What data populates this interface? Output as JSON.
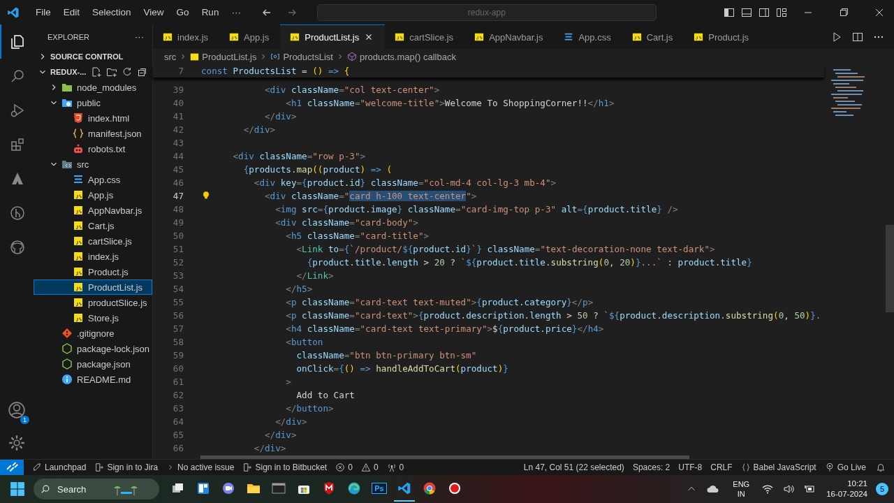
{
  "titlebar": {
    "menu": [
      "File",
      "Edit",
      "Selection",
      "View",
      "Go",
      "Run",
      "···"
    ],
    "command_center": "redux-app"
  },
  "activity_bar": [
    {
      "kind": "explorer",
      "selected": true
    },
    {
      "kind": "search",
      "selected": false
    },
    {
      "kind": "debug",
      "selected": false
    },
    {
      "kind": "extensions",
      "selected": false
    },
    {
      "kind": "atlassian",
      "selected": false
    },
    {
      "kind": "git-graph",
      "selected": false
    },
    {
      "kind": "github",
      "selected": false
    }
  ],
  "accounts_badge": "1",
  "sidebar": {
    "title": "EXPLORER",
    "more": "···",
    "sections": [
      {
        "label": "SOURCE CONTROL",
        "expanded": false
      },
      {
        "label": "REDUX-...",
        "expanded": true,
        "children": [
          {
            "name": "node_modules",
            "kind": "folder-node",
            "expanded": false,
            "selected": false
          },
          {
            "name": "public",
            "kind": "folder-public",
            "expanded": true,
            "selected": false,
            "children": [
              {
                "name": "index.html",
                "kind": "html",
                "selected": false
              },
              {
                "name": "manifest.json",
                "kind": "json",
                "selected": false
              },
              {
                "name": "robots.txt",
                "kind": "robot",
                "selected": false
              }
            ]
          },
          {
            "name": "src",
            "kind": "folder-src",
            "expanded": true,
            "selected": false,
            "children": [
              {
                "name": "App.css",
                "kind": "css",
                "selected": false
              },
              {
                "name": "App.js",
                "kind": "js",
                "selected": false
              },
              {
                "name": "AppNavbar.js",
                "kind": "js",
                "selected": false
              },
              {
                "name": "Cart.js",
                "kind": "js",
                "selected": false
              },
              {
                "name": "cartSlice.js",
                "kind": "js",
                "selected": false
              },
              {
                "name": "index.js",
                "kind": "js",
                "selected": false
              },
              {
                "name": "Product.js",
                "kind": "js",
                "selected": false
              },
              {
                "name": "ProductList.js",
                "kind": "js",
                "selected": true
              },
              {
                "name": "productSlice.js",
                "kind": "js",
                "selected": false
              },
              {
                "name": "Store.js",
                "kind": "js",
                "selected": false
              }
            ]
          },
          {
            "name": ".gitignore",
            "kind": "git",
            "selected": false
          },
          {
            "name": "package-lock.json",
            "kind": "npm",
            "selected": false
          },
          {
            "name": "package.json",
            "kind": "npm",
            "selected": false
          },
          {
            "name": "README.md",
            "kind": "info",
            "selected": false
          }
        ]
      }
    ]
  },
  "tabs": [
    {
      "label": "index.js",
      "kind": "js",
      "selected": false
    },
    {
      "label": "App.js",
      "kind": "js",
      "selected": false
    },
    {
      "label": "ProductList.js",
      "kind": "js",
      "selected": true
    },
    {
      "label": "cartSlice.js",
      "kind": "js",
      "selected": false
    },
    {
      "label": "AppNavbar.js",
      "kind": "js",
      "selected": false
    },
    {
      "label": "App.css",
      "kind": "css",
      "selected": false
    },
    {
      "label": "Cart.js",
      "kind": "js",
      "selected": false
    },
    {
      "label": "Product.js",
      "kind": "js",
      "selected": false
    }
  ],
  "breadcrumbs": [
    {
      "label": "src",
      "kind": "folder"
    },
    {
      "label": "ProductList.js",
      "kind": "js"
    },
    {
      "label": "ProductsList",
      "kind": "variable"
    },
    {
      "label": "products.map() callback",
      "kind": "method"
    }
  ],
  "sticky_line": {
    "n": "7",
    "code": [
      {
        "kind": "k",
        "text": "const"
      },
      {
        "kind": "v",
        "text": " ProductsList"
      },
      {
        "kind": "t",
        "text": " = "
      },
      {
        "kind": "y",
        "text": "()"
      },
      {
        "kind": "k",
        "text": " =>"
      },
      {
        "kind": "y",
        "text": " {"
      }
    ]
  },
  "lines": [
    {
      "n": "39",
      "current": false,
      "code": [
        {
          "kind": "p",
          "text": "            <"
        },
        {
          "kind": "tag",
          "text": "div"
        },
        {
          "kind": "a",
          "text": " className"
        },
        {
          "kind": "p",
          "text": "="
        },
        {
          "kind": "s",
          "text": "\"col text-center\""
        },
        {
          "kind": "p",
          "text": ">"
        }
      ]
    },
    {
      "n": "40",
      "current": false,
      "code": [
        {
          "kind": "p",
          "text": "                <"
        },
        {
          "kind": "tag",
          "text": "h1"
        },
        {
          "kind": "a",
          "text": " className"
        },
        {
          "kind": "p",
          "text": "="
        },
        {
          "kind": "s",
          "text": "\"welcome-title\""
        },
        {
          "kind": "p",
          "text": ">"
        },
        {
          "kind": "t",
          "text": "Welcome To ShoppingCorner!!"
        },
        {
          "kind": "p",
          "text": "</"
        },
        {
          "kind": "tag",
          "text": "h1"
        },
        {
          "kind": "p",
          "text": ">"
        }
      ]
    },
    {
      "n": "41",
      "current": false,
      "code": [
        {
          "kind": "p",
          "text": "            </"
        },
        {
          "kind": "tag",
          "text": "div"
        },
        {
          "kind": "p",
          "text": ">"
        }
      ]
    },
    {
      "n": "42",
      "current": false,
      "code": [
        {
          "kind": "p",
          "text": "        </"
        },
        {
          "kind": "tag",
          "text": "div"
        },
        {
          "kind": "p",
          "text": ">"
        }
      ]
    },
    {
      "n": "43",
      "current": false
    },
    {
      "n": "44",
      "current": false,
      "code": [
        {
          "kind": "p",
          "text": "      <"
        },
        {
          "kind": "tag",
          "text": "div"
        },
        {
          "kind": "a",
          "text": " className"
        },
        {
          "kind": "p",
          "text": "="
        },
        {
          "kind": "s",
          "text": "\"row p-3\""
        },
        {
          "kind": "p",
          "text": ">"
        }
      ]
    },
    {
      "n": "45",
      "current": false,
      "code": [
        {
          "kind": "b",
          "text": "        {"
        },
        {
          "kind": "v",
          "text": "products"
        },
        {
          "kind": "t",
          "text": "."
        },
        {
          "kind": "f",
          "text": "map"
        },
        {
          "kind": "y",
          "text": "(("
        },
        {
          "kind": "v",
          "text": "product"
        },
        {
          "kind": "y",
          "text": ")"
        },
        {
          "kind": "k",
          "text": " =>"
        },
        {
          "kind": "y",
          "text": " ("
        }
      ]
    },
    {
      "n": "46",
      "current": false,
      "code": [
        {
          "kind": "p",
          "text": "          <"
        },
        {
          "kind": "tag",
          "text": "div"
        },
        {
          "kind": "a",
          "text": " key"
        },
        {
          "kind": "p",
          "text": "="
        },
        {
          "kind": "b",
          "text": "{"
        },
        {
          "kind": "v",
          "text": "product"
        },
        {
          "kind": "t",
          "text": "."
        },
        {
          "kind": "v",
          "text": "id"
        },
        {
          "kind": "b",
          "text": "}"
        },
        {
          "kind": "a",
          "text": " className"
        },
        {
          "kind": "p",
          "text": "="
        },
        {
          "kind": "s",
          "text": "\"col-md-4 col-lg-3 mb-4\""
        },
        {
          "kind": "p",
          "text": ">"
        }
      ]
    },
    {
      "n": "47",
      "current": true,
      "code": [
        {
          "kind": "p",
          "text": "            <"
        },
        {
          "kind": "tag",
          "text": "div"
        },
        {
          "kind": "a",
          "text": " className"
        },
        {
          "kind": "p",
          "text": "="
        },
        {
          "kind": "s",
          "text": "\""
        },
        {
          "kind": "sel",
          "text": "card h-100 text-center"
        },
        {
          "kind": "s",
          "text": "\""
        },
        {
          "kind": "p",
          "text": ">"
        }
      ]
    },
    {
      "n": "48",
      "current": false,
      "code": [
        {
          "kind": "p",
          "text": "              <"
        },
        {
          "kind": "tag",
          "text": "img"
        },
        {
          "kind": "a",
          "text": " src"
        },
        {
          "kind": "p",
          "text": "="
        },
        {
          "kind": "b",
          "text": "{"
        },
        {
          "kind": "v",
          "text": "product"
        },
        {
          "kind": "t",
          "text": "."
        },
        {
          "kind": "v",
          "text": "image"
        },
        {
          "kind": "b",
          "text": "}"
        },
        {
          "kind": "a",
          "text": " className"
        },
        {
          "kind": "p",
          "text": "="
        },
        {
          "kind": "s",
          "text": "\"card-img-top p-3\""
        },
        {
          "kind": "a",
          "text": " alt"
        },
        {
          "kind": "p",
          "text": "="
        },
        {
          "kind": "b",
          "text": "{"
        },
        {
          "kind": "v",
          "text": "product"
        },
        {
          "kind": "t",
          "text": "."
        },
        {
          "kind": "v",
          "text": "title"
        },
        {
          "kind": "b",
          "text": "}"
        },
        {
          "kind": "p",
          "text": " />"
        }
      ]
    },
    {
      "n": "49",
      "current": false,
      "code": [
        {
          "kind": "p",
          "text": "              <"
        },
        {
          "kind": "tag",
          "text": "div"
        },
        {
          "kind": "a",
          "text": " className"
        },
        {
          "kind": "p",
          "text": "="
        },
        {
          "kind": "s",
          "text": "\"card-body\""
        },
        {
          "kind": "p",
          "text": ">"
        }
      ]
    },
    {
      "n": "50",
      "current": false,
      "code": [
        {
          "kind": "p",
          "text": "                <"
        },
        {
          "kind": "tag",
          "text": "h5"
        },
        {
          "kind": "a",
          "text": " className"
        },
        {
          "kind": "p",
          "text": "="
        },
        {
          "kind": "s",
          "text": "\"card-title\""
        },
        {
          "kind": "p",
          "text": ">"
        }
      ]
    },
    {
      "n": "51",
      "current": false,
      "code": [
        {
          "kind": "p",
          "text": "                  <"
        },
        {
          "kind": "c",
          "text": "Link"
        },
        {
          "kind": "a",
          "text": " to"
        },
        {
          "kind": "p",
          "text": "="
        },
        {
          "kind": "b",
          "text": "{"
        },
        {
          "kind": "s",
          "text": "`/product/"
        },
        {
          "kind": "b",
          "text": "${"
        },
        {
          "kind": "v",
          "text": "product"
        },
        {
          "kind": "t",
          "text": "."
        },
        {
          "kind": "v",
          "text": "id"
        },
        {
          "kind": "b",
          "text": "}"
        },
        {
          "kind": "s",
          "text": "`"
        },
        {
          "kind": "b",
          "text": "}"
        },
        {
          "kind": "a",
          "text": " className"
        },
        {
          "kind": "p",
          "text": "="
        },
        {
          "kind": "s",
          "text": "\"text-decoration-none text-dark\""
        },
        {
          "kind": "p",
          "text": ">"
        }
      ]
    },
    {
      "n": "52",
      "current": false,
      "code": [
        {
          "kind": "b",
          "text": "                    {"
        },
        {
          "kind": "v",
          "text": "product"
        },
        {
          "kind": "t",
          "text": "."
        },
        {
          "kind": "v",
          "text": "title"
        },
        {
          "kind": "t",
          "text": "."
        },
        {
          "kind": "v",
          "text": "length"
        },
        {
          "kind": "t",
          "text": " > "
        },
        {
          "kind": "n",
          "text": "20"
        },
        {
          "kind": "t",
          "text": " ? "
        },
        {
          "kind": "s",
          "text": "`"
        },
        {
          "kind": "b",
          "text": "${"
        },
        {
          "kind": "v",
          "text": "product"
        },
        {
          "kind": "t",
          "text": "."
        },
        {
          "kind": "v",
          "text": "title"
        },
        {
          "kind": "t",
          "text": "."
        },
        {
          "kind": "f",
          "text": "substring"
        },
        {
          "kind": "y",
          "text": "("
        },
        {
          "kind": "n",
          "text": "0"
        },
        {
          "kind": "t",
          "text": ", "
        },
        {
          "kind": "n",
          "text": "20"
        },
        {
          "kind": "y",
          "text": ")"
        },
        {
          "kind": "b",
          "text": "}"
        },
        {
          "kind": "s",
          "text": "...`"
        },
        {
          "kind": "t",
          "text": " : "
        },
        {
          "kind": "v",
          "text": "product"
        },
        {
          "kind": "t",
          "text": "."
        },
        {
          "kind": "v",
          "text": "title"
        },
        {
          "kind": "b",
          "text": "}"
        }
      ]
    },
    {
      "n": "53",
      "current": false,
      "code": [
        {
          "kind": "p",
          "text": "                  </"
        },
        {
          "kind": "c",
          "text": "Link"
        },
        {
          "kind": "p",
          "text": ">"
        }
      ]
    },
    {
      "n": "54",
      "current": false,
      "code": [
        {
          "kind": "p",
          "text": "                </"
        },
        {
          "kind": "tag",
          "text": "h5"
        },
        {
          "kind": "p",
          "text": ">"
        }
      ]
    },
    {
      "n": "55",
      "current": false,
      "code": [
        {
          "kind": "p",
          "text": "                <"
        },
        {
          "kind": "tag",
          "text": "p"
        },
        {
          "kind": "a",
          "text": " className"
        },
        {
          "kind": "p",
          "text": "="
        },
        {
          "kind": "s",
          "text": "\"card-text text-muted\""
        },
        {
          "kind": "p",
          "text": ">"
        },
        {
          "kind": "b",
          "text": "{"
        },
        {
          "kind": "v",
          "text": "product"
        },
        {
          "kind": "t",
          "text": "."
        },
        {
          "kind": "v",
          "text": "category"
        },
        {
          "kind": "b",
          "text": "}"
        },
        {
          "kind": "p",
          "text": "</"
        },
        {
          "kind": "tag",
          "text": "p"
        },
        {
          "kind": "p",
          "text": ">"
        }
      ]
    },
    {
      "n": "56",
      "current": false,
      "code": [
        {
          "kind": "p",
          "text": "                <"
        },
        {
          "kind": "tag",
          "text": "p"
        },
        {
          "kind": "a",
          "text": " className"
        },
        {
          "kind": "p",
          "text": "="
        },
        {
          "kind": "s",
          "text": "\"card-text\""
        },
        {
          "kind": "p",
          "text": ">"
        },
        {
          "kind": "b",
          "text": "{"
        },
        {
          "kind": "v",
          "text": "product"
        },
        {
          "kind": "t",
          "text": "."
        },
        {
          "kind": "v",
          "text": "description"
        },
        {
          "kind": "t",
          "text": "."
        },
        {
          "kind": "v",
          "text": "length"
        },
        {
          "kind": "t",
          "text": " > "
        },
        {
          "kind": "n",
          "text": "50"
        },
        {
          "kind": "t",
          "text": " ? "
        },
        {
          "kind": "s",
          "text": "`"
        },
        {
          "kind": "b",
          "text": "${"
        },
        {
          "kind": "v",
          "text": "product"
        },
        {
          "kind": "t",
          "text": "."
        },
        {
          "kind": "v",
          "text": "description"
        },
        {
          "kind": "t",
          "text": "."
        },
        {
          "kind": "f",
          "text": "substring"
        },
        {
          "kind": "y",
          "text": "("
        },
        {
          "kind": "n",
          "text": "0"
        },
        {
          "kind": "t",
          "text": ", "
        },
        {
          "kind": "n",
          "text": "50"
        },
        {
          "kind": "y",
          "text": ")"
        },
        {
          "kind": "b",
          "text": "}"
        },
        {
          "kind": "s",
          "text": "."
        }
      ]
    },
    {
      "n": "57",
      "current": false,
      "code": [
        {
          "kind": "p",
          "text": "                <"
        },
        {
          "kind": "tag",
          "text": "h4"
        },
        {
          "kind": "a",
          "text": " className"
        },
        {
          "kind": "p",
          "text": "="
        },
        {
          "kind": "s",
          "text": "\"card-text text-primary\""
        },
        {
          "kind": "p",
          "text": ">"
        },
        {
          "kind": "t",
          "text": "$"
        },
        {
          "kind": "b",
          "text": "{"
        },
        {
          "kind": "v",
          "text": "product"
        },
        {
          "kind": "t",
          "text": "."
        },
        {
          "kind": "v",
          "text": "price"
        },
        {
          "kind": "b",
          "text": "}"
        },
        {
          "kind": "p",
          "text": "</"
        },
        {
          "kind": "tag",
          "text": "h4"
        },
        {
          "kind": "p",
          "text": ">"
        }
      ]
    },
    {
      "n": "58",
      "current": false,
      "code": [
        {
          "kind": "p",
          "text": "                <"
        },
        {
          "kind": "tag",
          "text": "button"
        }
      ]
    },
    {
      "n": "59",
      "current": false,
      "code": [
        {
          "kind": "a",
          "text": "                  className"
        },
        {
          "kind": "p",
          "text": "="
        },
        {
          "kind": "s",
          "text": "\"btn btn-primary btn-sm\""
        }
      ]
    },
    {
      "n": "60",
      "current": false,
      "code": [
        {
          "kind": "a",
          "text": "                  onClick"
        },
        {
          "kind": "p",
          "text": "="
        },
        {
          "kind": "b",
          "text": "{"
        },
        {
          "kind": "y",
          "text": "()"
        },
        {
          "kind": "k",
          "text": " =>"
        },
        {
          "kind": "f",
          "text": " handleAddToCart"
        },
        {
          "kind": "y",
          "text": "("
        },
        {
          "kind": "v",
          "text": "product"
        },
        {
          "kind": "y",
          "text": ")"
        },
        {
          "kind": "b",
          "text": "}"
        }
      ]
    },
    {
      "n": "61",
      "current": false,
      "code": [
        {
          "kind": "p",
          "text": "                >"
        }
      ]
    },
    {
      "n": "62",
      "current": false,
      "code": [
        {
          "kind": "t",
          "text": "                  Add to Cart"
        }
      ]
    },
    {
      "n": "63",
      "current": false,
      "code": [
        {
          "kind": "p",
          "text": "                </"
        },
        {
          "kind": "tag",
          "text": "button"
        },
        {
          "kind": "p",
          "text": ">"
        }
      ]
    },
    {
      "n": "64",
      "current": false,
      "code": [
        {
          "kind": "p",
          "text": "              </"
        },
        {
          "kind": "tag",
          "text": "div"
        },
        {
          "kind": "p",
          "text": ">"
        }
      ]
    },
    {
      "n": "65",
      "current": false,
      "code": [
        {
          "kind": "p",
          "text": "            </"
        },
        {
          "kind": "tag",
          "text": "div"
        },
        {
          "kind": "p",
          "text": ">"
        }
      ]
    },
    {
      "n": "66",
      "current": false,
      "code": [
        {
          "kind": "p",
          "text": "          </"
        },
        {
          "kind": "tag",
          "text": "div"
        },
        {
          "kind": "p",
          "text": ">"
        }
      ]
    }
  ],
  "status_bar": {
    "left": [
      {
        "kind": "launchpad",
        "label": "Launchpad"
      },
      {
        "kind": "jira",
        "label": "Sign in to Jira"
      },
      {
        "kind": "issue",
        "label": "No active issue"
      },
      {
        "kind": "bitbucket",
        "label": "Sign in to Bitbucket"
      },
      {
        "kind": "errors",
        "label": "0"
      },
      {
        "kind": "warnings",
        "label": "0"
      },
      {
        "kind": "ports",
        "label": "0"
      }
    ],
    "right": [
      {
        "kind": "plain",
        "label": "Ln 47, Col 51 (22 selected)"
      },
      {
        "kind": "plain",
        "label": "Spaces: 2"
      },
      {
        "kind": "plain",
        "label": "UTF-8"
      },
      {
        "kind": "plain",
        "label": "CRLF"
      },
      {
        "kind": "braces",
        "label": "Babel JavaScript"
      },
      {
        "kind": "golive",
        "label": "Go Live"
      }
    ]
  },
  "taskbar": {
    "search_placeholder": "Search",
    "apps": [
      {
        "kind": "task-view",
        "selected": false
      },
      {
        "kind": "widgets",
        "selected": false
      },
      {
        "kind": "meet",
        "selected": false
      },
      {
        "kind": "folder",
        "selected": false
      },
      {
        "kind": "terminal",
        "selected": false
      },
      {
        "kind": "store",
        "selected": false
      },
      {
        "kind": "shield",
        "selected": false
      },
      {
        "kind": "edge",
        "selected": false
      },
      {
        "kind": "ps",
        "label": "Ps",
        "selected": false
      },
      {
        "kind": "vscode",
        "selected": true
      },
      {
        "kind": "chrome",
        "selected": false
      },
      {
        "kind": "record",
        "selected": false
      }
    ],
    "language": [
      "ENG",
      "IN"
    ],
    "time": "10:21",
    "date": "16-07-2024",
    "notification_count": "5"
  }
}
